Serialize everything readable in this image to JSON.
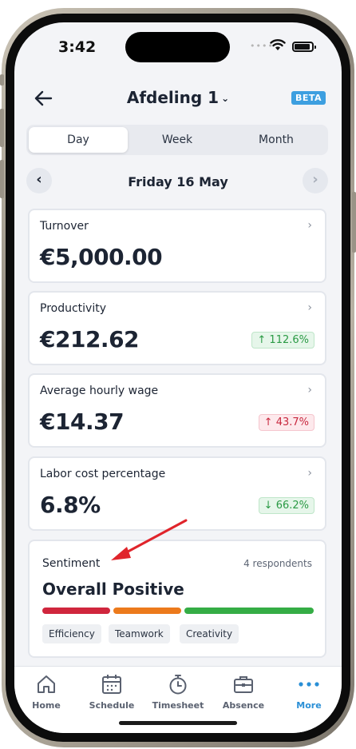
{
  "status_bar": {
    "time": "3:42"
  },
  "header": {
    "title": "Afdeling 1",
    "beta": "BETA"
  },
  "tabs": [
    {
      "label": "Day",
      "active": true
    },
    {
      "label": "Week",
      "active": false
    },
    {
      "label": "Month",
      "active": false
    }
  ],
  "date_nav": {
    "label": "Friday 16 May"
  },
  "metrics": [
    {
      "title": "Turnover",
      "value": "€5,000.00",
      "badge": null
    },
    {
      "title": "Productivity",
      "value": "€212.62",
      "badge": {
        "text": "↑ 112.6%",
        "tone": "green"
      }
    },
    {
      "title": "Average hourly wage",
      "value": "€14.37",
      "badge": {
        "text": "↑ 43.7%",
        "tone": "red"
      }
    },
    {
      "title": "Labor cost percentage",
      "value": "6.8%",
      "badge": {
        "text": "↓ 66.2%",
        "tone": "green"
      }
    }
  ],
  "sentiment": {
    "title": "Sentiment",
    "respondents": "4 respondents",
    "overall": "Overall Positive",
    "bars": [
      {
        "color": "#d0263d"
      },
      {
        "color": "#ec7a1c"
      },
      {
        "color": "#35ad45"
      }
    ],
    "tags": [
      "Efficiency",
      "Teamwork",
      "Creativity"
    ]
  },
  "bottom_nav": [
    {
      "label": "Home",
      "icon": "home-icon",
      "active": false
    },
    {
      "label": "Schedule",
      "icon": "calendar-icon",
      "active": false
    },
    {
      "label": "Timesheet",
      "icon": "stopwatch-icon",
      "active": false
    },
    {
      "label": "Absence",
      "icon": "briefcase-icon",
      "active": false
    },
    {
      "label": "More",
      "icon": "more-dots-icon",
      "active": true
    }
  ],
  "colors": {
    "accent": "#2a8fd6",
    "beta_badge": "#3d9fe0",
    "annotation_arrow": "#e0242b"
  }
}
